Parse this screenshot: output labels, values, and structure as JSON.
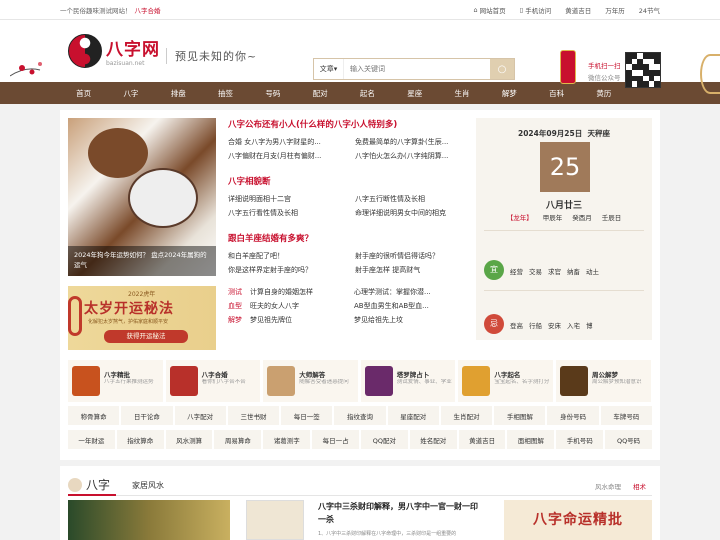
{
  "topbar": {
    "slogan": "一个民俗趣味测试网站！",
    "slogan_hl": "八字合婚",
    "links": [
      "网站首页",
      "手机访问",
      "黄道吉日",
      "万年历",
      "24节气"
    ]
  },
  "header": {
    "logo_cn": "八字网",
    "logo_en": "bazisuan.net",
    "tagline": "预见未知的你~",
    "search_type": "文章",
    "search_placeholder": "输入关键词",
    "phone_line1": "手机扫一扫",
    "phone_line2": "微信公众号"
  },
  "nav": [
    "首页",
    "八字",
    "排盘",
    "抽签",
    "号码",
    "配对",
    "起名",
    "星座",
    "生肖",
    "解梦",
    "百科",
    "黄历"
  ],
  "hero": {
    "caption": "2024年狗今年运势如何？ 盘点2024年属狗的运气"
  },
  "banner": {
    "year": "2022虎年",
    "title": "太岁开运秘法",
    "sub": "化解犯太岁煞气，护佑家庭和顺平安",
    "cta": "获得开运秘法"
  },
  "sections": [
    {
      "title": "八字公布还有小人(什么样的八字小人特别多)",
      "rows": [
        [
          "合婚 女八字为男八字财星的...",
          "免费最简单的八字算卦(生辰..."
        ],
        [
          "八字偏财在月支(月柱有偏财...",
          "八字怕火怎么办(八字纯阴算..."
        ]
      ]
    },
    {
      "title": "八字相貌断",
      "rows": [
        [
          "详细说明面相十二宫",
          "八字五行断性情及长相"
        ],
        [
          "八字五行看性情及长相",
          "命理详细说明男女中间的相克"
        ]
      ]
    },
    {
      "title": "跟白羊座结婚有多爽？",
      "rows": [
        [
          "和白羊座配了吧！",
          "射手座的很听情侣得话吗？"
        ],
        [
          "你是这样界定射手座的吗？",
          "射手座怎样 提高财气"
        ]
      ]
    }
  ],
  "cat_rows": [
    {
      "cat": "测试",
      "a": "计算自身的婚姻怎样",
      "b": "心理学测试：掌握你潜..."
    },
    {
      "cat": "血型",
      "a": "旺夫的女人八字",
      "b": "AB型血男生和AB型血..."
    },
    {
      "cat": "解梦",
      "a": "梦见祖先牌位",
      "b": "梦见给祖先上坟"
    }
  ],
  "calendar": {
    "date": "2024年09月25日",
    "constellation": "天秤座",
    "day": "25",
    "lunar": "八月廿三",
    "ganzhi": [
      "【龙年】",
      "甲辰年",
      "癸酉月",
      "壬辰日"
    ],
    "good_label": "宜",
    "good": [
      "经营",
      "交易",
      "求官",
      "纳畜",
      "动土"
    ],
    "bad_label": "忌",
    "bad": [
      "登高",
      "行船",
      "安床",
      "入宅",
      "博"
    ]
  },
  "tools": [
    {
      "t": "八字精批",
      "d": "八字五行果推测运势",
      "c": "#c8521e"
    },
    {
      "t": "八字合婚",
      "d": "看你们八字合不合",
      "c": "#b8302a"
    },
    {
      "t": "大师解答",
      "d": "随解答受者迷惑提问",
      "c": "#caa070"
    },
    {
      "t": "塔罗牌占卜",
      "d": "测试爱情、事业、学业",
      "c": "#6a2a6a"
    },
    {
      "t": "八字起名",
      "d": "宝宝起名、名字测打分",
      "c": "#e0a030"
    },
    {
      "t": "周公解梦",
      "d": "周公解梦预知潜意识",
      "c": "#5a3a1a"
    }
  ],
  "links1": [
    "称骨算命",
    "日干论命",
    "八字配对",
    "三世书财",
    "每日一签",
    "指纹查询",
    "星座配对",
    "生肖配对",
    "手相图解",
    "身份号码",
    "车牌号码"
  ],
  "links2": [
    "一年财运",
    "指纹算命",
    "风水测算",
    "周易算命",
    "诸葛测字",
    "每日一占",
    "QQ配对",
    "姓名配对",
    "黄道吉日",
    "面相图解",
    "手机号码",
    "QQ号码"
  ],
  "bottom": {
    "tab1": "八字",
    "tab2": "家居风水",
    "more1": "风水命理",
    "more2": "相术",
    "title": "八字中三杀财印解释，男八字中一官一财一印一杀",
    "desc": "1、八字中三杀财印解释在八字命理中，三杀财印是一组重要的",
    "ad": "八字命运精批"
  }
}
